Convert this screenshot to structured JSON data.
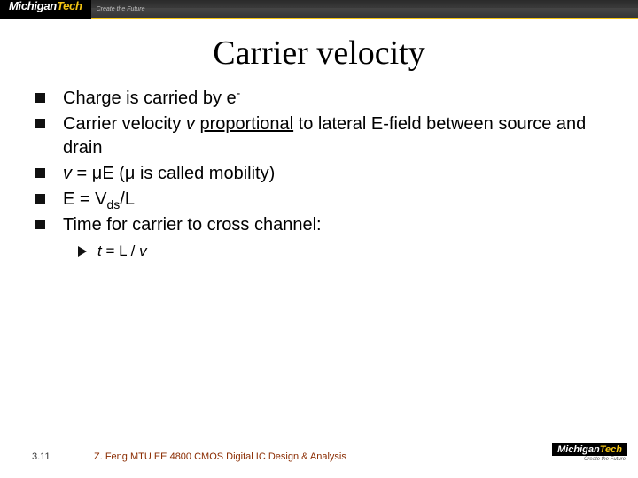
{
  "header": {
    "logo_part1": "Michigan",
    "logo_part2": "Tech",
    "tagline": "Create the Future"
  },
  "title": "Carrier velocity",
  "bullets": [
    {
      "pre": "Charge is carried by e",
      "sup": "-"
    },
    {
      "pre": "Carrier velocity ",
      "ital": "v",
      "post1": " ",
      "u": "proportional",
      "post2": " to lateral E-field between source and drain"
    },
    {
      "ital": "v",
      "post1": " = ",
      "mu1": "μ",
      "post2": "E (",
      "mu2": "μ",
      "post3": "  is called mobility)"
    },
    {
      "pre": "E = V",
      "sub": "ds",
      "post": "/L"
    },
    {
      "pre": "Time for carrier to cross channel:"
    }
  ],
  "subbullet": {
    "ital1": "t",
    "mid": " = L / ",
    "ital2": "v"
  },
  "footer": {
    "pagenum": "3.11",
    "course": "Z. Feng  MTU EE 4800 CMOS Digital IC Design & Analysis",
    "logo_part1": "Michigan",
    "logo_part2": "Tech",
    "tagline": "Create the Future"
  }
}
